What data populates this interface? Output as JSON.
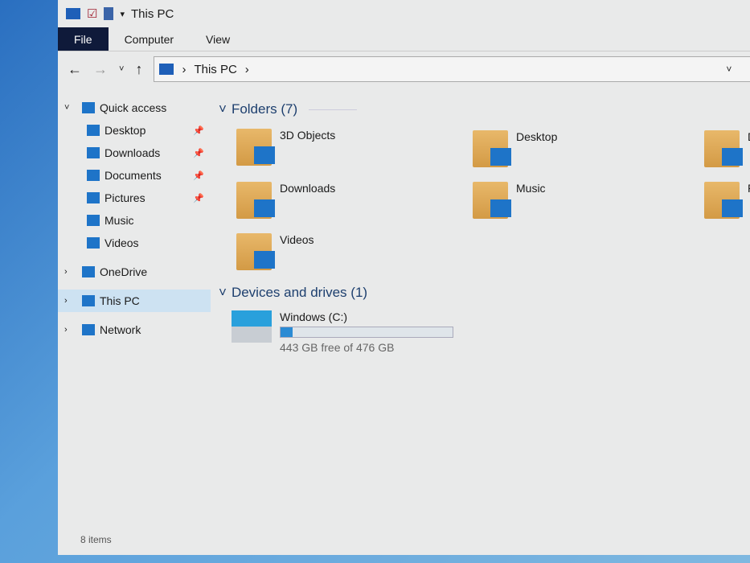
{
  "window": {
    "title": "This PC",
    "status": "8 items"
  },
  "ribbon": {
    "tabs": [
      "File",
      "Computer",
      "View"
    ]
  },
  "address": {
    "path": "This PC",
    "separator": "›"
  },
  "sidebar": {
    "items": [
      {
        "label": "Quick access",
        "icon": "star-icon",
        "level": 0,
        "expanded": true
      },
      {
        "label": "Desktop",
        "icon": "desktop-icon",
        "level": 1,
        "pinned": true
      },
      {
        "label": "Downloads",
        "icon": "download-icon",
        "level": 1,
        "pinned": true
      },
      {
        "label": "Documents",
        "icon": "document-icon",
        "level": 1,
        "pinned": true
      },
      {
        "label": "Pictures",
        "icon": "picture-icon",
        "level": 1,
        "pinned": true
      },
      {
        "label": "Music",
        "icon": "music-icon",
        "level": 1
      },
      {
        "label": "Videos",
        "icon": "video-icon",
        "level": 1
      },
      {
        "label": "OneDrive",
        "icon": "cloud-icon",
        "level": 0
      },
      {
        "label": "This PC",
        "icon": "computer-icon",
        "level": 0,
        "selected": true
      },
      {
        "label": "Network",
        "icon": "network-icon",
        "level": 0
      }
    ]
  },
  "folders": {
    "header": "Folders (7)",
    "items": [
      "3D Objects",
      "Desktop",
      "D",
      "Downloads",
      "Music",
      "P",
      "Videos"
    ]
  },
  "drives": {
    "header": "Devices and drives (1)",
    "items": [
      {
        "name": "Windows (C:)",
        "free_text": "443 GB free of 476 GB",
        "used_fraction": 0.069
      }
    ]
  },
  "colors": {
    "accent": "#2b8bd4",
    "file_tab": "#0f1a3a"
  }
}
